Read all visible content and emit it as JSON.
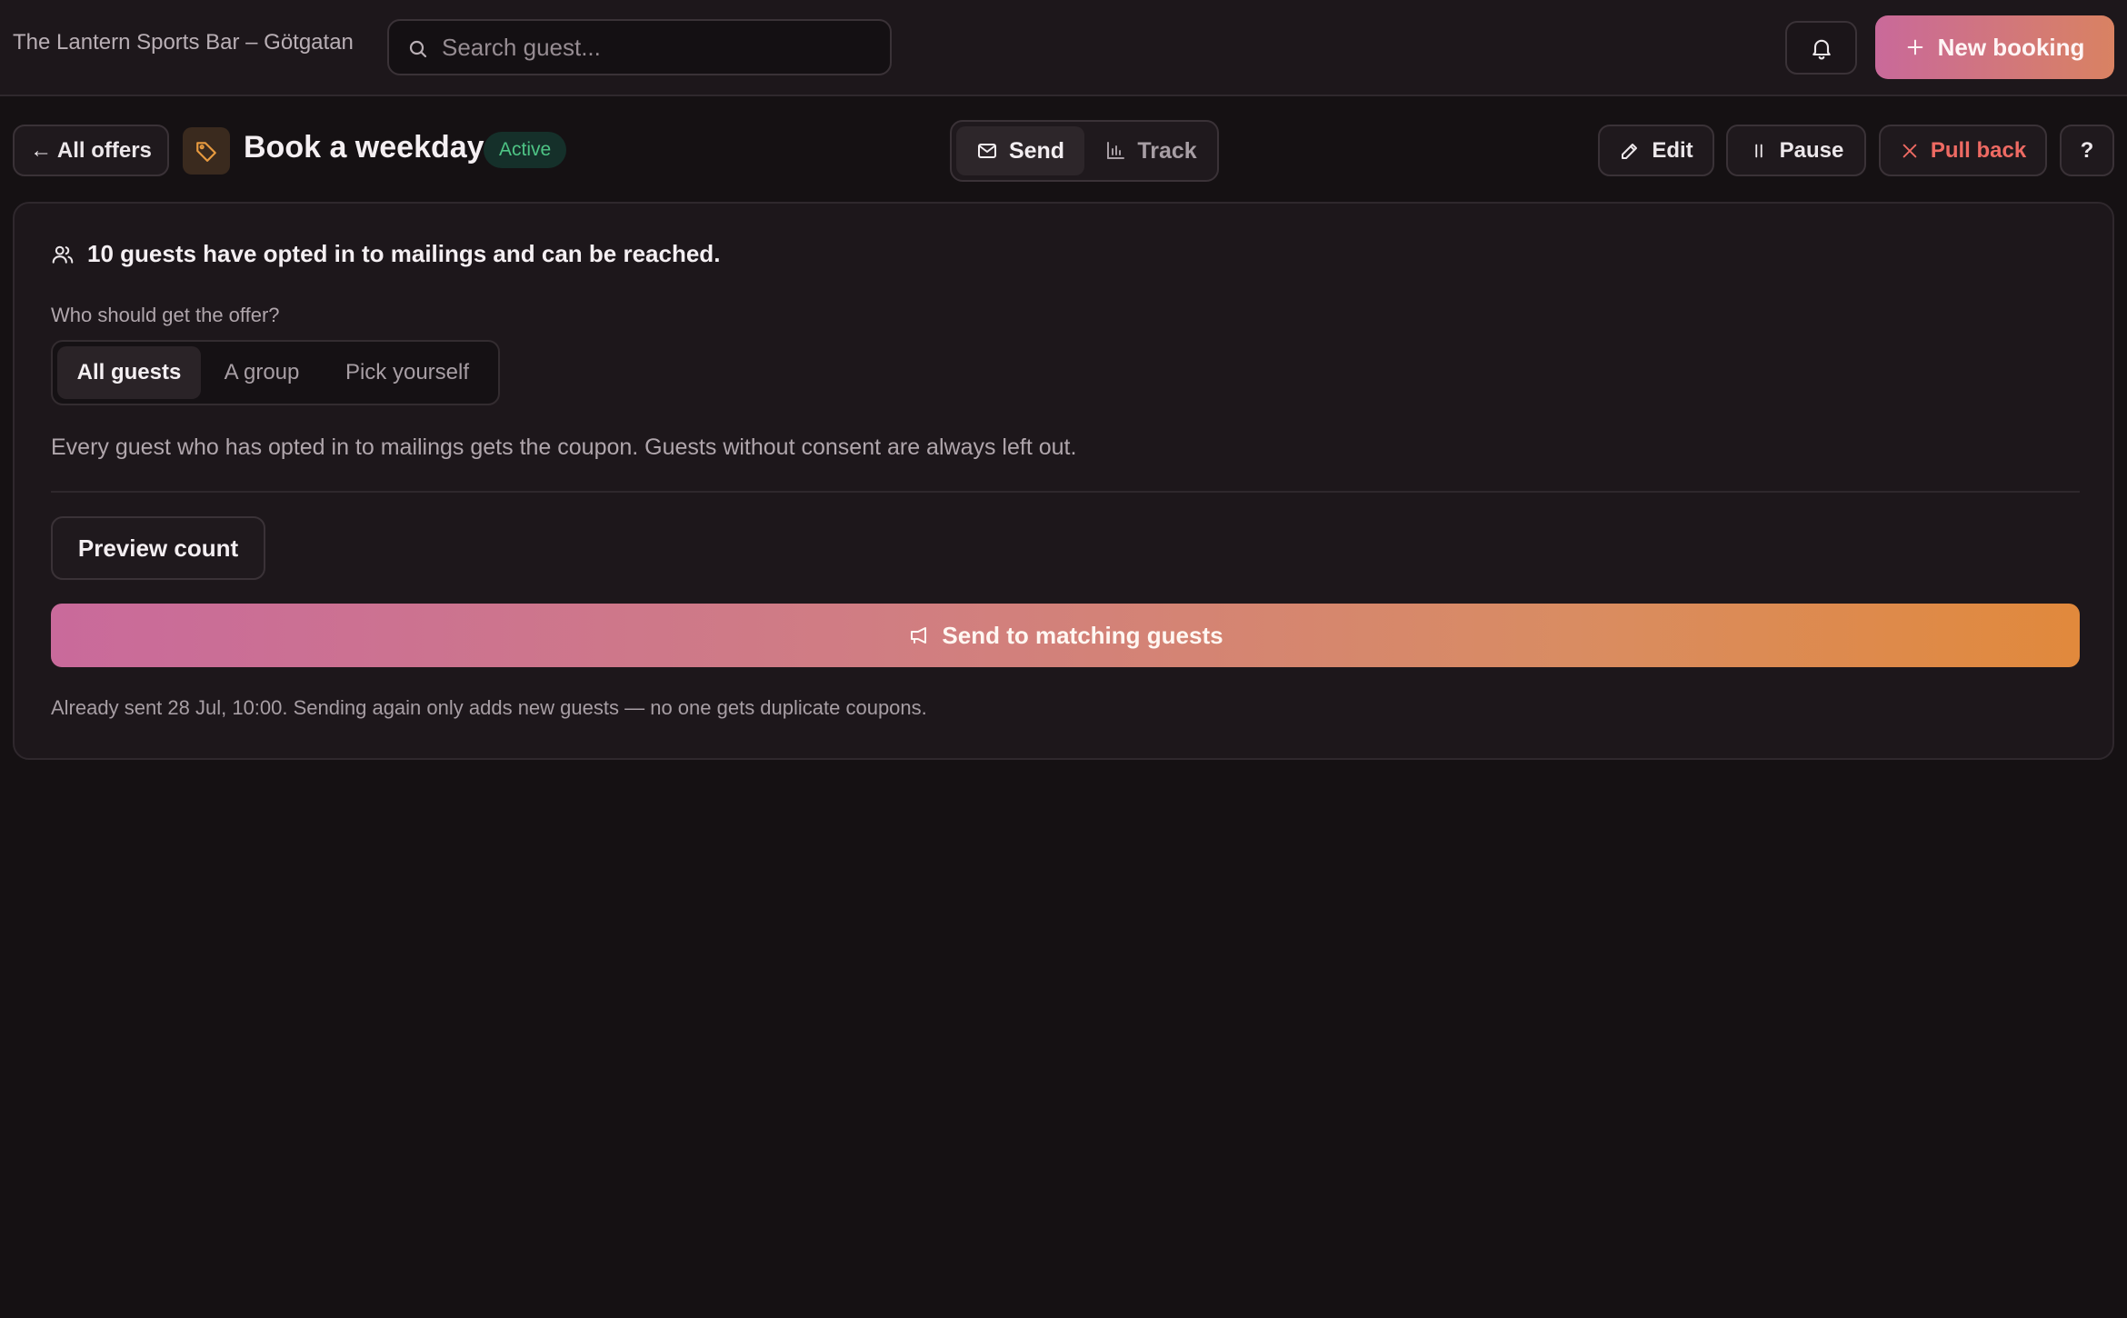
{
  "header": {
    "venue": "The Lantern Sports Bar – Götgatan",
    "search_placeholder": "Search guest...",
    "new_booking_label": "New booking"
  },
  "subheader": {
    "back_label": "← All offers",
    "offer_title": "Book a weekday",
    "status_badge": "Active",
    "tabs": [
      {
        "label": "Send",
        "icon": "mail-icon",
        "selected": true
      },
      {
        "label": "Track",
        "icon": "bar-chart-icon",
        "selected": false
      }
    ],
    "actions": {
      "edit": "Edit",
      "pause": "Pause",
      "pull_back": "Pull back",
      "help": "?"
    }
  },
  "card": {
    "reach_text": "10 guests have opted in to mailings and can be reached.",
    "question": "Who should get the offer?",
    "audience_options": [
      {
        "label": "All guests",
        "selected": true
      },
      {
        "label": "A group",
        "selected": false
      },
      {
        "label": "Pick yourself",
        "selected": false
      }
    ],
    "explanation": "Every guest who has opted in to mailings gets the coupon. Guests without consent are always left out.",
    "preview_label": "Preview count",
    "send_label": "Send to matching guests",
    "note": "Already sent 28 Jul, 10:00. Sending again only adds new guests — no one gets duplicate coupons."
  },
  "colors": {
    "background": "#151113",
    "surface": "#1d171b",
    "accent_gradient_start": "#c9699a",
    "accent_gradient_end": "#e1893c",
    "status_active": "#4ec485",
    "danger": "#ee6a63"
  }
}
